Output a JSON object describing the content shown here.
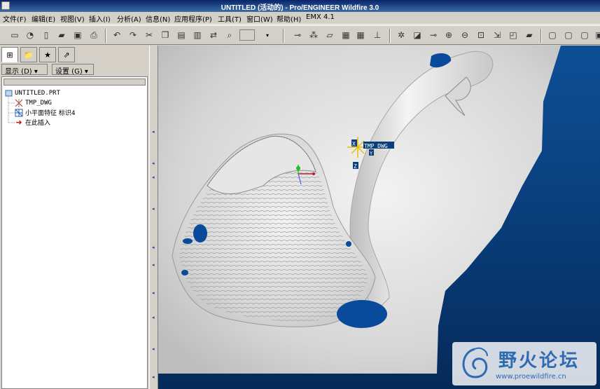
{
  "window": {
    "title": "UNTITLED (活动的) - Pro/ENGINEER Wildfire 3.0"
  },
  "menubar": {
    "items": [
      "文件(F)",
      "编辑(E)",
      "视图(V)",
      "插入(I)",
      "分析(A)",
      "信息(N)",
      "应用程序(P)",
      "工具(T)",
      "窗口(W)",
      "帮助(H)",
      "EMX 4.1"
    ]
  },
  "nav": {
    "display_menu": "显示 (D) ▾",
    "settings_menu": "设置 (G) ▾"
  },
  "tree": {
    "items": [
      {
        "label": "UNTITLED.PRT",
        "icon": "part-icon"
      },
      {
        "label": "TMP_DWG",
        "icon": "coordinate-system-icon"
      },
      {
        "label": "小平面特征 标识4",
        "icon": "facet-feature-icon"
      },
      {
        "label": "在此插入",
        "icon": "insert-arrow-icon"
      }
    ]
  },
  "viewport": {
    "csys_label": "TMP_DWG",
    "axis_x": "X",
    "axis_y": "Y",
    "axis_z": "Z"
  },
  "watermark": {
    "title": "野火论坛",
    "url": "www.proewildfire.cn"
  },
  "colors": {
    "background_blue": "#0b3c78",
    "highlight_blue": "#0a4a9a",
    "titlebar": "#0a246a"
  }
}
